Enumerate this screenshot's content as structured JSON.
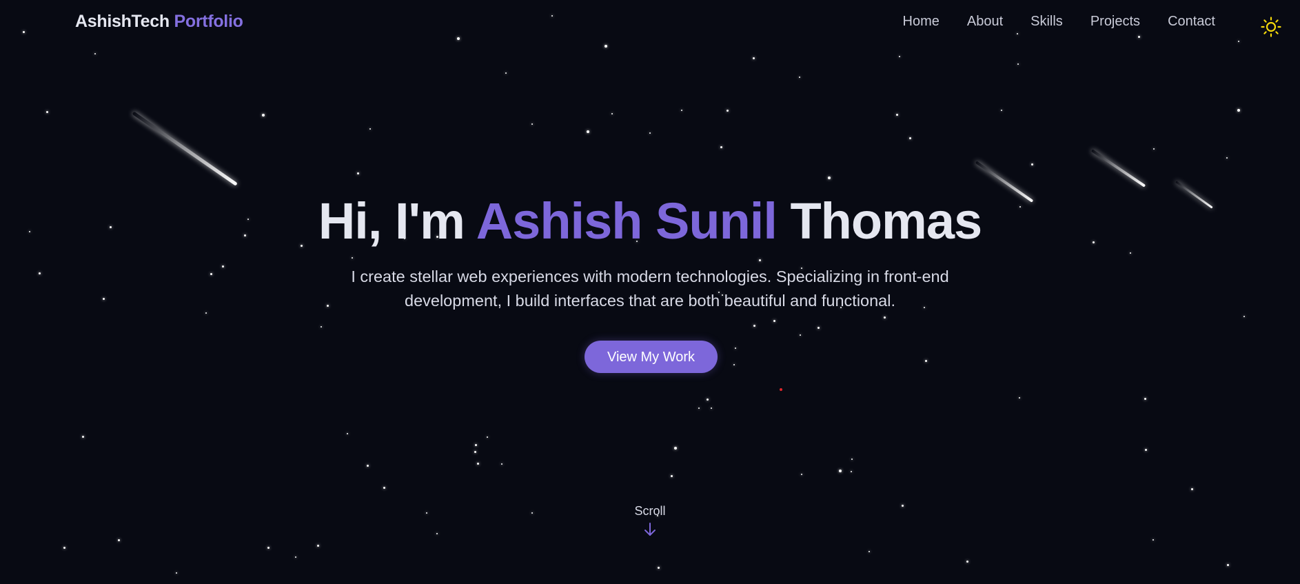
{
  "header": {
    "brand_main": "AshishTech",
    "brand_accent": "Portfolio",
    "nav": [
      "Home",
      "About",
      "Skills",
      "Projects",
      "Contact"
    ],
    "theme_icon": "sun-icon"
  },
  "hero": {
    "greeting": "Hi, I'm",
    "name_accent": "Ashish Sunil",
    "name_rest": "Thomas",
    "subtitle": "I create stellar web experiences with modern technologies. Specializing in front-end development, I build interfaces that are both beautiful and functional.",
    "cta_label": "View My Work",
    "scroll_label": "Scroll",
    "scroll_icon": "arrow-down-icon"
  },
  "colors": {
    "background": "#080a13",
    "accent": "#7d67da",
    "text": "#e5e7f0",
    "sun": "#f5d90a"
  }
}
